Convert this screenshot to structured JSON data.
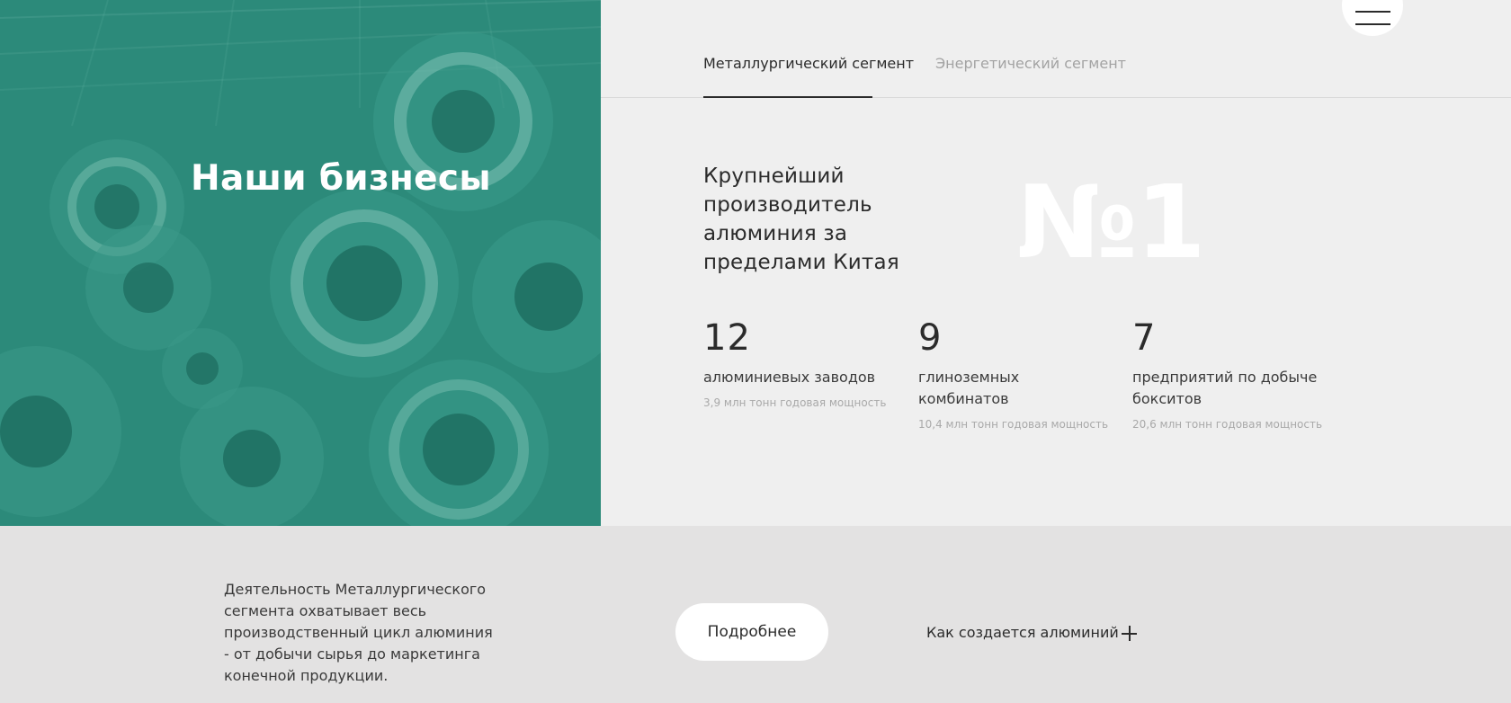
{
  "hero": {
    "title": "Наши бизнесы",
    "image": "aluminium-coils-photo",
    "overlay_color": "#2c8a7a"
  },
  "tabs": [
    {
      "label": "Металлургический сегмент",
      "active": true
    },
    {
      "label": "Энергетический сегмент",
      "active": false
    }
  ],
  "menu": {
    "icon": "hamburger-menu-icon"
  },
  "headline": "Крупнейший производитель алюминия за пределами Китая",
  "big_number": "№1",
  "stats": [
    {
      "value": "12",
      "label": "алюминиевых заводов",
      "note": "3,9 млн тонн годовая мощность"
    },
    {
      "value": "9",
      "label": "глиноземных комбинатов",
      "note": "10,4 млн тонн годовая мощность"
    },
    {
      "value": "7",
      "label": "предприятий по добыче бокситов",
      "note": "20,6 млн тонн годовая мощность"
    }
  ],
  "description": "Деятельность Металлургического сегмента охватывает весь производственный цикл алюминия - от добычи сырья до маркетинга конечной продукции.",
  "more_button": "Подробнее",
  "how_link": {
    "label": "Как создается алюминий",
    "icon": "plus-icon"
  },
  "colors": {
    "accent": "#2c8a7a",
    "text": "#2b2b2b",
    "muted": "#a3a3a3"
  }
}
